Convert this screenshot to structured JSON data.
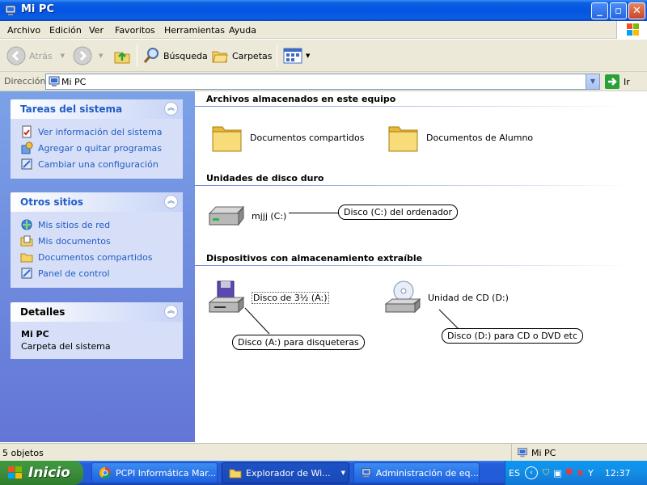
{
  "window": {
    "title": "Mi PC"
  },
  "menu": [
    "Archivo",
    "Edición",
    "Ver",
    "Favoritos",
    "Herramientas",
    "Ayuda"
  ],
  "toolbar": {
    "back_label": "Atrás",
    "search_label": "Búsqueda",
    "folders_label": "Carpetas"
  },
  "address": {
    "label": "Dirección",
    "value": "Mi PC",
    "go_label": "Ir"
  },
  "left": {
    "system_tasks": {
      "title": "Tareas del sistema",
      "items": [
        "Ver información del sistema",
        "Agregar o quitar programas",
        "Cambiar una configuración"
      ]
    },
    "other_places": {
      "title": "Otros sitios",
      "items": [
        "Mis sitios de red",
        "Mis documentos",
        "Documentos compartidos",
        "Panel de control"
      ]
    },
    "details": {
      "title": "Detalles",
      "name": "Mi PC",
      "subtitle": "Carpeta del sistema"
    }
  },
  "content": {
    "sections": [
      {
        "title": "Archivos almacenados en este equipo",
        "items": [
          "Documentos compartidos",
          "Documentos de Alumno"
        ]
      },
      {
        "title": "Unidades de disco duro",
        "items": [
          "mjjj (C:)"
        ]
      },
      {
        "title": "Dispositivos con almacenamiento extraíble",
        "items": [
          "Disco de 3½ (A:)",
          "Unidad de CD (D:)"
        ]
      }
    ],
    "callouts": [
      "Disco (C:) del ordenador",
      "Disco (A:) para disqueteras",
      "Disco (D:) para CD o DVD etc"
    ]
  },
  "status": {
    "count": "5 objetos",
    "zone": "Mi PC"
  },
  "taskbar": {
    "start_label": "Inicio",
    "buttons": [
      "PCPI Informática Mar...",
      "Explorador de Wi...",
      "Administración de eq..."
    ],
    "lang": "ES",
    "clock": "12:37"
  }
}
